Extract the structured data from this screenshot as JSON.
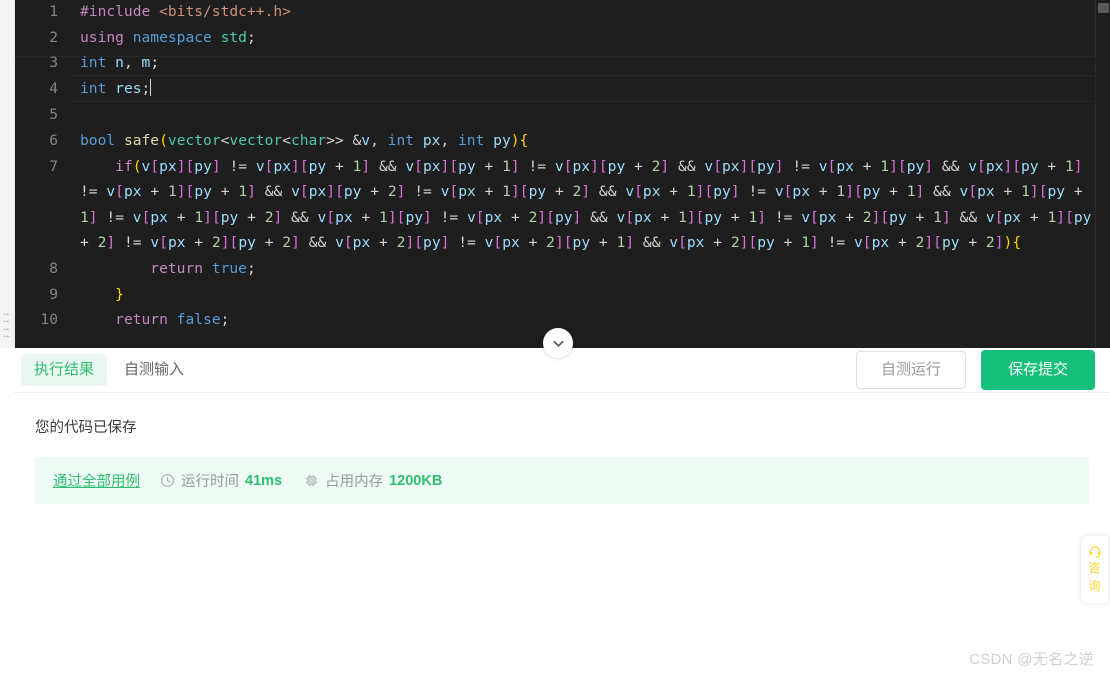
{
  "editor": {
    "language": "cpp",
    "theme_background": "#1e1e1e",
    "active_line": 4,
    "lines": [
      {
        "no": "1",
        "text": "#include <bits/stdc++.h>"
      },
      {
        "no": "2",
        "text": "using namespace std;"
      },
      {
        "no": "3",
        "text": "int n, m;"
      },
      {
        "no": "4",
        "text": "int res;"
      },
      {
        "no": "5",
        "text": ""
      },
      {
        "no": "6",
        "text": "bool safe(vector<vector<char>> &v, int px, int py){"
      },
      {
        "no": "7",
        "text": "    if(v[px][py] != v[px][py + 1] && v[px][py + 1] != v[px][py + 2] && v[px][py] != v[px + 1][py] && v[px][py + 1] != v[px + 1][py + 1] && v[px][py + 2] != v[px + 1][py + 2] && v[px + 1][py] != v[px + 1][py + 1] && v[px + 1][py + 1] != v[px + 1][py + 2] && v[px + 1][py] != v[px + 2][py] && v[px + 1][py + 1] != v[px + 2][py + 1] && v[px + 1][py + 2] != v[px + 2][py + 2] && v[px + 2][py] != v[px + 2][py + 1] && v[px + 2][py + 1] != v[px + 2][py + 2]){"
      },
      {
        "no": "8",
        "text": "        return true;"
      },
      {
        "no": "9",
        "text": "    }"
      },
      {
        "no": "10",
        "text": "    return false;"
      }
    ]
  },
  "panel": {
    "tabs": [
      {
        "label": "执行结果",
        "active": true
      },
      {
        "label": "自测输入",
        "active": false
      }
    ],
    "actions": {
      "run_label": "自测运行",
      "submit_label": "保存提交"
    },
    "save_message": "您的代码已保存",
    "result": {
      "status_label": "通过全部用例",
      "time_label": "运行时间",
      "time_value": "41ms",
      "memory_label": "占用内存",
      "memory_value": "1200KB",
      "time_icon": "clock-icon",
      "memory_icon": "chip-icon"
    }
  },
  "collapse": {
    "icon": "chevron-down-icon",
    "title": "收起"
  },
  "consult": {
    "icon": "headset-icon",
    "char1": "咨",
    "char2": "询"
  },
  "watermark": {
    "text": "CSDN @无名之逆"
  },
  "colors": {
    "accent_green": "#15bf79",
    "tab_active_bg": "#eaf8f1",
    "result_bg": "#eefaf4",
    "editor_bg": "#1e1e1e",
    "consult_yellow": "#ffd32a"
  }
}
